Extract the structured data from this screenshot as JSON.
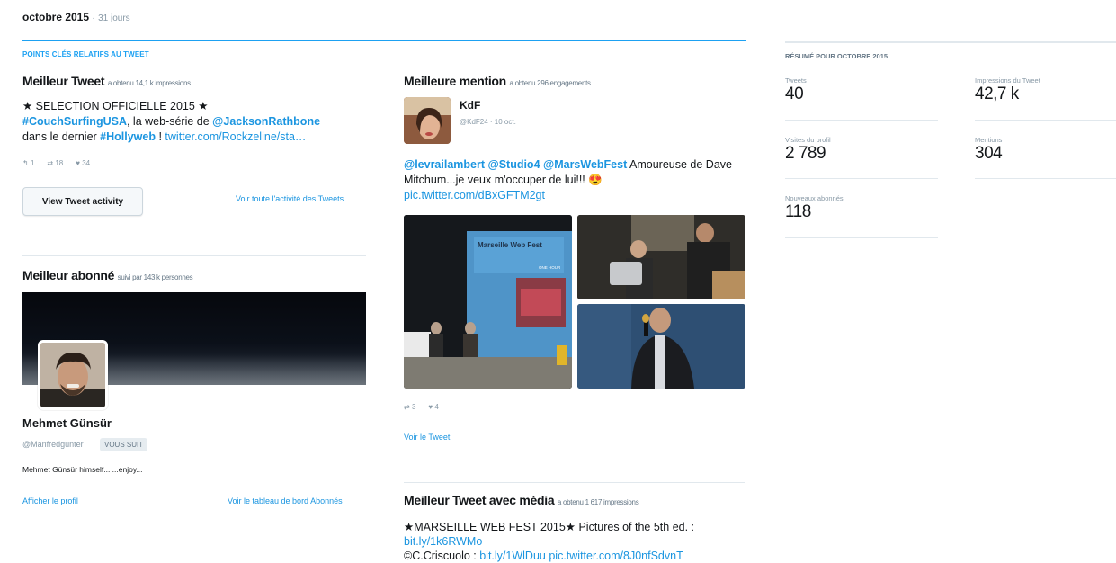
{
  "header": {
    "month": "octobre 2015",
    "separator": "·",
    "days": "31 jours"
  },
  "highlights": {
    "title": "POINTS CLÉS RELATIFS AU TWEET"
  },
  "top_tweet": {
    "title": "Meilleur Tweet",
    "subtitle": "a obtenu 14,1 k impressions",
    "line1": "★ SELECTION OFFICIELLE 2015 ★",
    "hashtag1": "#CouchSurfingUSA",
    "text1": ", la web-série de ",
    "mention1": "@JacksonRathbone",
    "text2": "dans le dernier ",
    "hashtag2": "#Hollyweb",
    "text3": " ! ",
    "link": "twitter.com/Rockzeline/sta…",
    "replies": "1",
    "retweets": "18",
    "likes": "34",
    "view_activity_label": "View Tweet activity",
    "all_activity_label": "Voir toute l'activité des Tweets"
  },
  "top_follower": {
    "title": "Meilleur abonné",
    "subtitle": "suivi par 143 k personnes",
    "name": "Mehmet Günsür",
    "handle": "@Manfredgunter",
    "badge": "VOUS SUIT",
    "bio": "Mehmet Günsür himself... ...enjoy...",
    "view_profile_label": "Afficher le profil",
    "dashboard_label": "Voir le tableau de bord Abonnés"
  },
  "top_mention": {
    "title": "Meilleure mention",
    "subtitle": "a obtenu 296 engagements",
    "name": "KdF",
    "handle_date": "@KdF24 · 10 oct.",
    "mention1": "@levrailambert",
    "mention2": "@Studio4",
    "mention3": "@MarsWebFest",
    "text1": " Amoureuse de Dave Mitchum...je veux m'occuper de lui!!! ",
    "emoji": "😍",
    "link": "pic.twitter.com/dBxGFTM2gt",
    "retweets": "3",
    "likes": "4",
    "view_tweet_label": "Voir le Tweet",
    "slide_title": "Marseille Web Fest",
    "slide_text": "ONE HOUR"
  },
  "top_media_tweet": {
    "title": "Meilleur Tweet avec média",
    "subtitle": "a obtenu 1 617 impressions",
    "line1": "★MARSEILLE WEB FEST 2015★ Pictures of the 5th ed. :",
    "link1": "bit.ly/1k6RWMo",
    "line3_prefix": "©C.Criscuolo : ",
    "link2": "bit.ly/1WlDuu",
    "link3": "pic.twitter.com/8J0nfSdvnT"
  },
  "summary": {
    "title": "RÉSUMÉ POUR OCTOBRE 2015",
    "stats": [
      {
        "label": "Tweets",
        "value": "40"
      },
      {
        "label": "Impressions du Tweet",
        "value": "42,7 k"
      },
      {
        "label": "Visites du profil",
        "value": "2 789"
      },
      {
        "label": "Mentions",
        "value": "304"
      },
      {
        "label": "Nouveaux abonnés",
        "value": "118"
      }
    ]
  },
  "icons": {
    "reply": "reply-icon",
    "retweet": "retweet-icon",
    "like": "heart-icon"
  },
  "colors": {
    "accent": "#1da1f2",
    "link": "#1b95e0",
    "muted": "#8899a6"
  }
}
